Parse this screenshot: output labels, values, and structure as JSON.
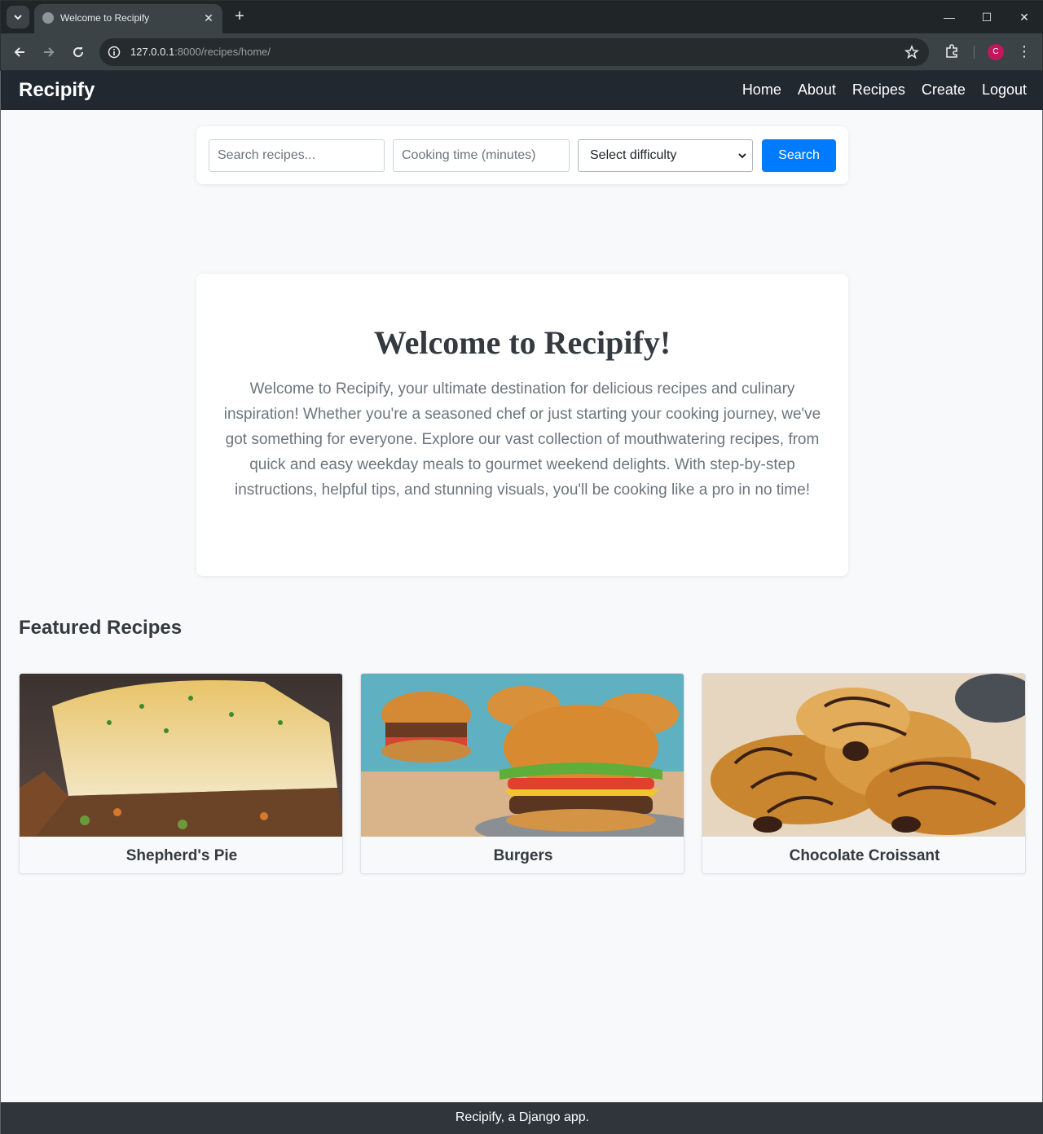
{
  "browser": {
    "tab_title": "Welcome to Recipify",
    "url_host": "127.0.0.1",
    "url_path": ":8000/recipes/home/",
    "profile_initial": "C"
  },
  "site": {
    "brand": "Recipify",
    "nav": [
      "Home",
      "About",
      "Recipes",
      "Create",
      "Logout"
    ]
  },
  "search": {
    "query_placeholder": "Search recipes...",
    "time_placeholder": "Cooking time (minutes)",
    "difficulty_selected": "Select difficulty",
    "button_label": "Search"
  },
  "welcome": {
    "title": "Welcome to Recipify!",
    "text": "Welcome to Recipify, your ultimate destination for delicious recipes and culinary inspiration! Whether you're a seasoned chef or just starting your cooking journey, we've got something for everyone. Explore our vast collection of mouthwatering recipes, from quick and easy weekday meals to gourmet weekend delights. With step-by-step instructions, helpful tips, and stunning visuals, you'll be cooking like a pro in no time!"
  },
  "featured": {
    "title": "Featured Recipes",
    "recipes": [
      {
        "name": "Shepherd's Pie"
      },
      {
        "name": "Burgers"
      },
      {
        "name": "Chocolate Croissant"
      }
    ]
  },
  "footer": {
    "text": "Recipify, a Django app."
  },
  "colors": {
    "navbar": "#212830",
    "primary": "#007bff",
    "footer": "#2f353b",
    "page_bg": "#f8f9fa"
  }
}
